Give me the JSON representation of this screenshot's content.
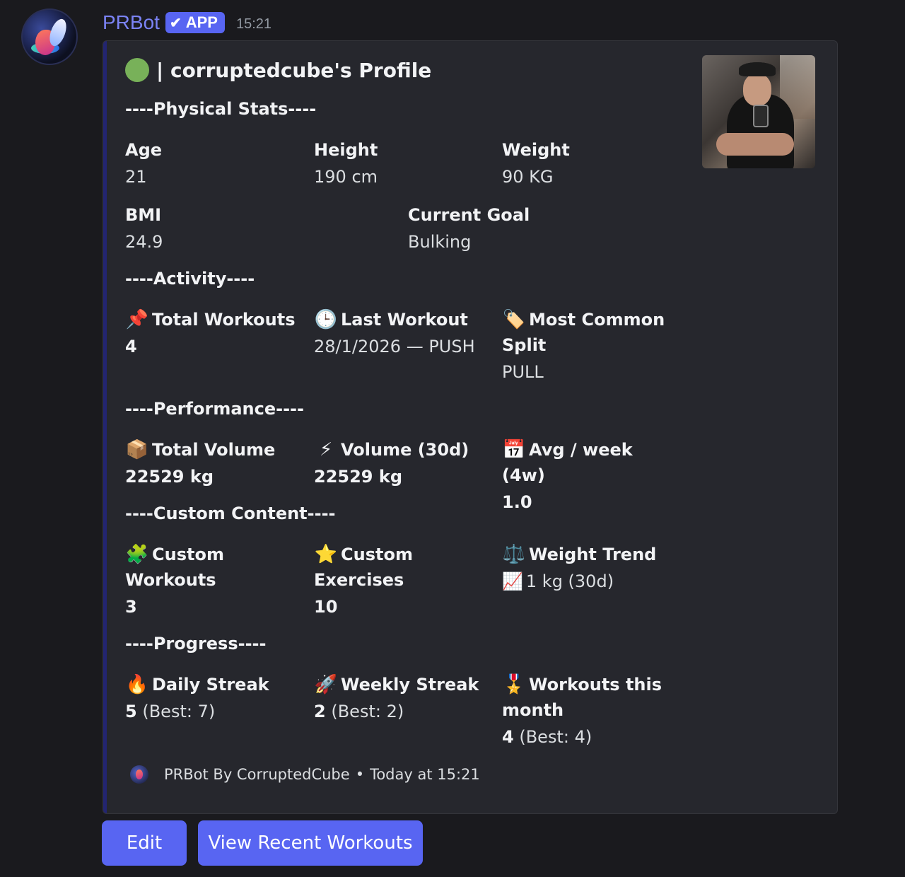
{
  "author": {
    "name": "PRBot",
    "badge": "APP",
    "badge_check": "✔",
    "time": "15:21"
  },
  "embed": {
    "status_icon": "green-circle",
    "title": "| corruptedcube's Profile",
    "sections": {
      "physical": "----Physical Stats----",
      "activity": "----Activity----",
      "performance": "----Performance----",
      "custom": "----Custom Content----",
      "progress": "----Progress----"
    },
    "physical": {
      "age": {
        "name": "Age",
        "value": "21"
      },
      "height": {
        "name": "Height",
        "value": "190 cm"
      },
      "weight": {
        "name": "Weight",
        "value": "90 KG"
      },
      "bmi": {
        "name": "BMI",
        "value": "24.9"
      },
      "goal": {
        "name": "Current Goal",
        "value": "Bulking"
      }
    },
    "activity": {
      "total_workouts": {
        "icon": "📌",
        "name": "Total Workouts",
        "value": "4"
      },
      "last_workout": {
        "icon": "🕒",
        "name": "Last Workout",
        "value": "28/1/2026 — PUSH"
      },
      "common_split": {
        "icon": "🏷️",
        "name": "Most Common Split",
        "value": "PULL"
      }
    },
    "performance": {
      "total_volume": {
        "icon": "📦",
        "name": "Total Volume",
        "value": "22529 kg"
      },
      "volume_30d": {
        "icon": "⚡",
        "name": "Volume (30d)",
        "value": "22529 kg"
      },
      "avg_week": {
        "icon": "📅",
        "name": "Avg / week (4w)",
        "value": "1.0"
      }
    },
    "custom": {
      "workouts": {
        "icon": "🧩",
        "name": "Custom Workouts",
        "value": "3"
      },
      "exercises": {
        "icon": "⭐",
        "name": "Custom Exercises",
        "value": "10"
      },
      "weight_trend": {
        "icon": "⚖️",
        "name": "Weight Trend",
        "trend_icon": "📈",
        "value": "1 kg (30d)"
      }
    },
    "progress": {
      "daily": {
        "icon": "🔥",
        "name": "Daily Streak",
        "value": "5",
        "best": "(Best: 7)"
      },
      "weekly": {
        "icon": "🚀",
        "name": "Weekly Streak",
        "value": "2",
        "best": "(Best: 2)"
      },
      "monthly": {
        "icon": "🎖️",
        "name": "Workouts this month",
        "value": "4",
        "best": "(Best: 4)"
      }
    },
    "footer": {
      "text": "PRBot By CorruptedCube",
      "separator": "•",
      "time": "Today at 15:21"
    }
  },
  "buttons": {
    "edit": "Edit",
    "recent": "View Recent Workouts"
  },
  "colors": {
    "accent": "#5865f2",
    "username": "#7b83f5",
    "embed_bar": "#232571",
    "status_dot": "#78b159"
  }
}
